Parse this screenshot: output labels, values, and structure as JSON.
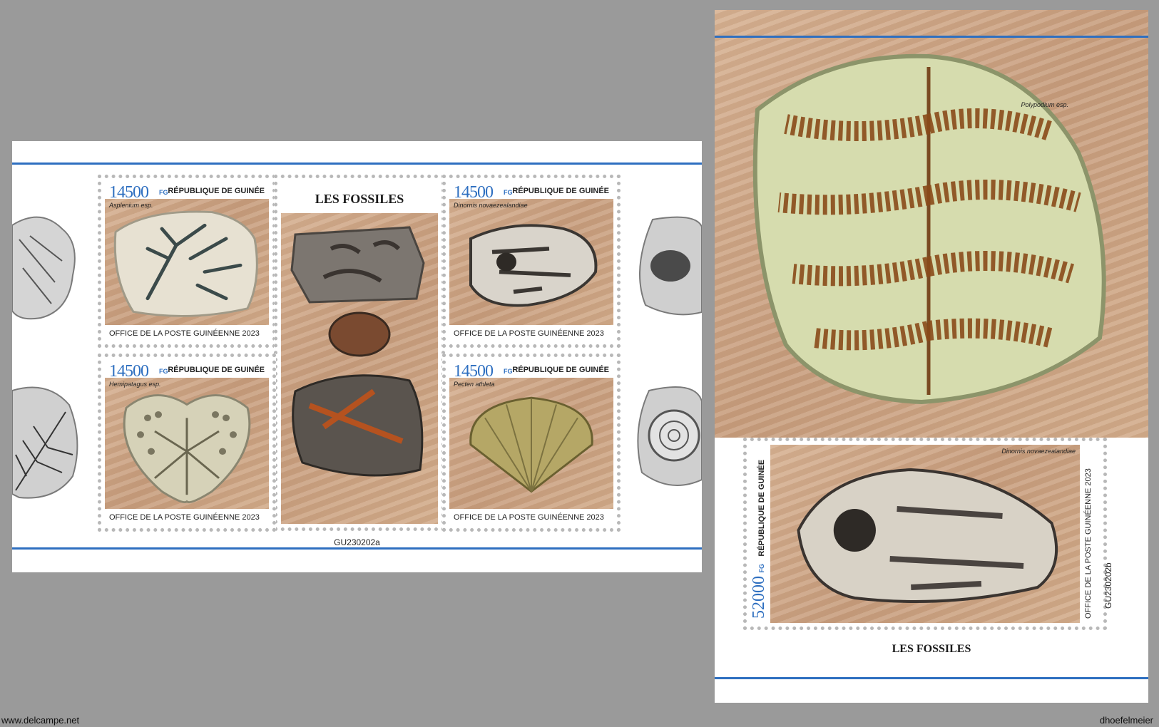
{
  "watermarks": {
    "left": "www.delcampe.net",
    "right": "dhoefelmeier"
  },
  "sheet_a": {
    "title": "LES FOSSILES",
    "code": "GU230202a",
    "stamps": [
      {
        "value": "14500",
        "currency": "FG",
        "country": "RÉPUBLIQUE DE GUINÉE",
        "species": "Asplenium esp.",
        "office": "OFFICE DE LA POSTE GUINÉENNE 2023"
      },
      {
        "value": "14500",
        "currency": "FG",
        "country": "RÉPUBLIQUE DE GUINÉE",
        "species": "Dinornis novaezealandiae",
        "office": "OFFICE DE LA POSTE GUINÉENNE 2023"
      },
      {
        "value": "14500",
        "currency": "FG",
        "country": "RÉPUBLIQUE DE GUINÉE",
        "species": "Hemipatagus esp.",
        "office": "OFFICE DE LA POSTE GUINÉENNE 2023"
      },
      {
        "value": "14500",
        "currency": "FG",
        "country": "RÉPUBLIQUE DE GUINÉE",
        "species": "Pecten athleta",
        "office": "OFFICE DE LA POSTE GUINÉENNE 2023"
      }
    ]
  },
  "sheet_b": {
    "title": "LES FOSSILES",
    "code": "GU230202b",
    "caption": "Polypodium esp.",
    "stamp": {
      "value": "52000",
      "currency": "FG",
      "country": "RÉPUBLIQUE DE GUINÉE",
      "species": "Dinornis novaezealandiae",
      "office": "OFFICE DE LA POSTE GUINÉENNE 2023"
    }
  },
  "colors": {
    "accent": "#2e6fc0",
    "background": "#9a9a9a",
    "sand": "#d1aa89"
  }
}
